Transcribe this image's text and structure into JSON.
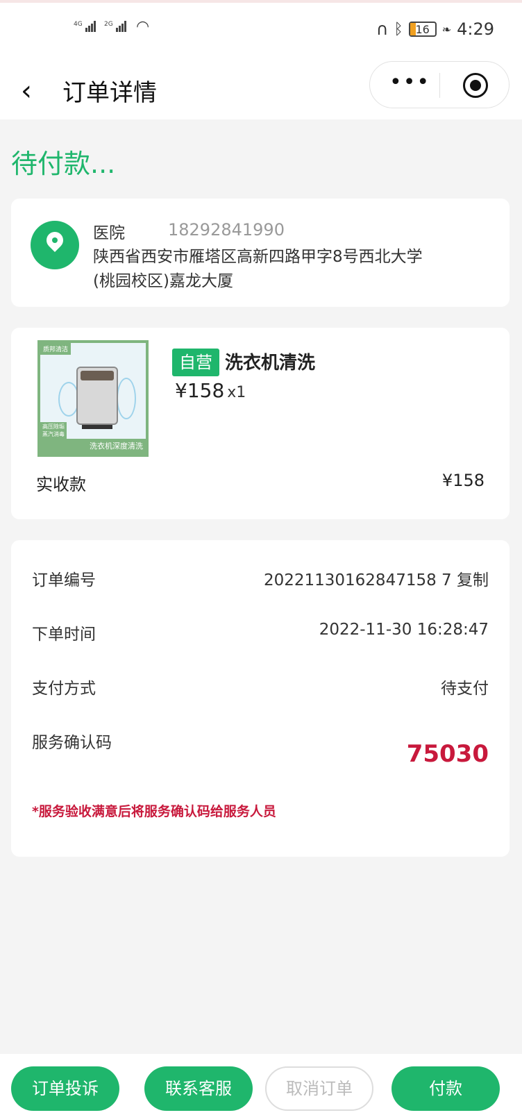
{
  "status_bar": {
    "sig1": "4G",
    "sig2": "2G",
    "battery": "16",
    "time": "4:29"
  },
  "nav": {
    "back_icon": "chevron-left-icon",
    "title": "订单详情",
    "more_icon": "more-dots-icon",
    "close_icon": "target-circle-icon"
  },
  "order_status": "待付款...",
  "address": {
    "icon": "location-pin-icon",
    "name": "医院",
    "phone": "18292841990",
    "detail": "陕西省西安市雁塔区高新四路甲字8号西北大学(桃园校区)嘉龙大厦"
  },
  "goods": {
    "image_tag_top": "质邦清洁",
    "image_tag_side_1": "高压除垢",
    "image_tag_side_2": "蒸汽消毒",
    "image_tag_bottom": "洗衣机深度清洗",
    "self_tag": "自营",
    "name": "洗衣机清洗",
    "price": "¥158",
    "qty": "x1",
    "pay_label": "实收款",
    "pay_value": "¥158"
  },
  "info": {
    "order_no_label": "订单编号",
    "order_no_value": "20221130162847158 7 复制",
    "order_time_label": "下单时间",
    "order_time_value": "2022-11-30 16:28:47",
    "pay_method_label": "支付方式",
    "pay_method_value": "待支付",
    "confirm_code_label": "服务确认码",
    "confirm_code_value": "75030",
    "note": "*服务验收满意后将服务确认码给服务人员"
  },
  "actions": {
    "complain": "订单投诉",
    "contact": "联系客服",
    "cancel": "取消订单",
    "pay": "付款"
  },
  "colors": {
    "accent": "#1fb66c",
    "alert": "#c8193c"
  }
}
